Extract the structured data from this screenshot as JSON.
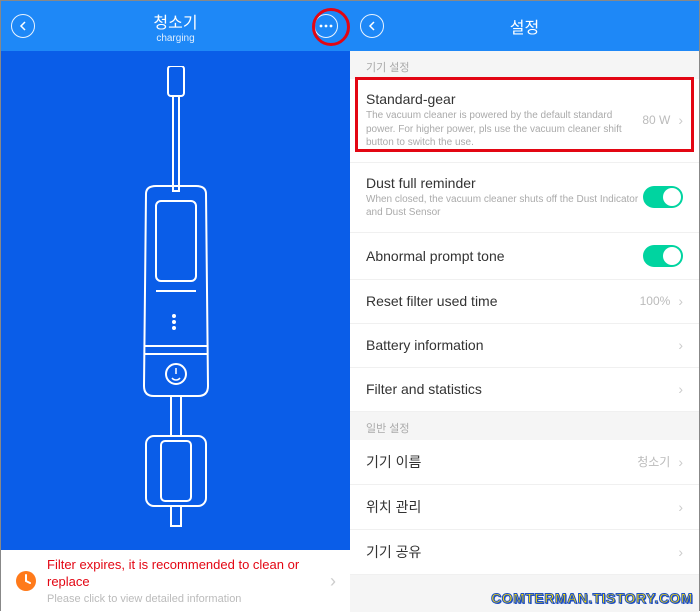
{
  "left": {
    "title": "청소기",
    "status": "charging",
    "banner": {
      "title": "Filter expires, it is recommended to clean or replace",
      "sub": "Please click to view detailed information"
    }
  },
  "right": {
    "title": "설정",
    "section_device": "기기 설정",
    "section_general": "일반 설정",
    "rows": {
      "gear": {
        "title": "Standard-gear",
        "desc": "The vacuum cleaner is powered by the default standard power. For higher power, pls use the vacuum cleaner shift button to switch the use.",
        "value": "80 W"
      },
      "dust": {
        "title": "Dust full reminder",
        "desc": "When closed, the vacuum cleaner shuts off the Dust Indicator and Dust Sensor"
      },
      "abnormal": {
        "title": "Abnormal prompt tone"
      },
      "reset": {
        "title": "Reset filter used time",
        "value": "100%"
      },
      "battery": {
        "title": "Battery information"
      },
      "filter": {
        "title": "Filter and statistics"
      },
      "name": {
        "title": "기기 이름",
        "value": "청소기"
      },
      "location": {
        "title": "위치 관리"
      },
      "share": {
        "title": "기기 공유"
      }
    }
  },
  "watermark": "COMTERMAN.TISTORY.COM"
}
